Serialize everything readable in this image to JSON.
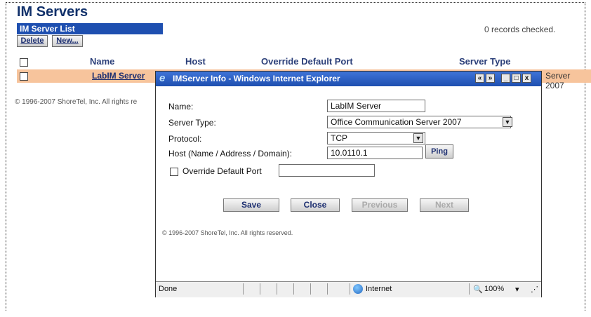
{
  "page": {
    "title": "IM Servers",
    "list_bar": "IM Server List",
    "records_checked": "0 records checked.",
    "buttons": {
      "delete": "Delete",
      "new": "New..."
    },
    "columns": [
      "Name",
      "Host",
      "Override Default Port",
      "Server Type"
    ],
    "row": {
      "name": "LabIM Server",
      "server_type_partial": "Server 2007"
    },
    "copyright": "© 1996-2007 ShoreTel, Inc. All rights re"
  },
  "popup": {
    "title": "IMServer Info - Windows Internet Explorer",
    "controls": {
      "minimize": "_",
      "maximize": "□",
      "close": "x"
    },
    "fields": {
      "name_label": "Name:",
      "name_value": "LabIM Server",
      "server_type_label": "Server Type:",
      "server_type_value": "Office Communication Server 2007",
      "protocol_label": "Protocol:",
      "protocol_value": "TCP",
      "host_label": "Host (Name / Address / Domain):",
      "host_value": "10.0110.1",
      "override_label": "Override Default Port",
      "override_value": ""
    },
    "ping_label": "Ping",
    "actions": {
      "save": "Save",
      "close": "Close",
      "previous": "Previous",
      "next": "Next"
    },
    "copyright": "© 1996-2007 ShoreTel, Inc. All rights reserved.",
    "statusbar": {
      "done": "Done",
      "zone": "Internet",
      "zoom": "100%"
    }
  },
  "colors": {
    "title_blue": "#10306a",
    "bar_blue": "#1e4fb0",
    "row_highlight": "#f7c49c"
  }
}
